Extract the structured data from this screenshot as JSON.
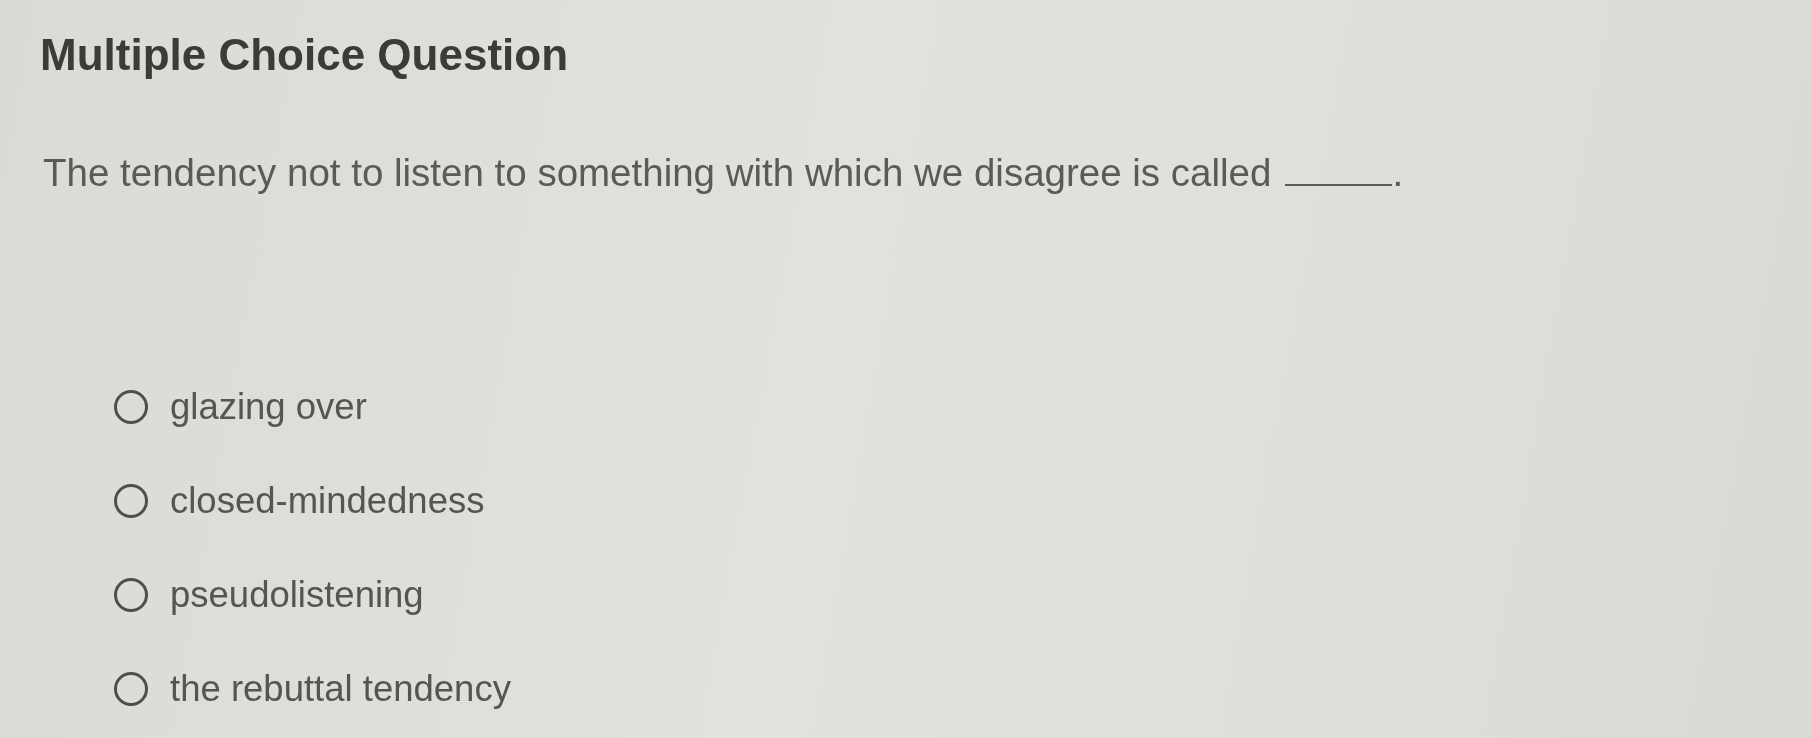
{
  "heading": "Multiple Choice Question",
  "question": {
    "before_blank": "The tendency not to listen to something with which we disagree is called",
    "after_blank": "."
  },
  "options": [
    {
      "label": "glazing over",
      "selected": false
    },
    {
      "label": "closed-mindedness",
      "selected": false
    },
    {
      "label": "pseudolistening",
      "selected": false
    },
    {
      "label": "the rebuttal tendency",
      "selected": false
    }
  ]
}
